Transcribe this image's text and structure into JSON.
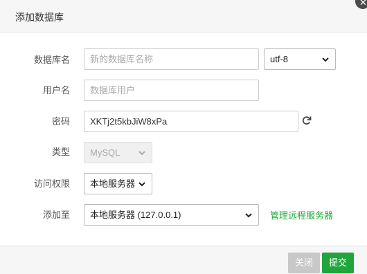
{
  "dialog": {
    "title": "添加数据库",
    "close_icon": "close-icon"
  },
  "form": {
    "db_name": {
      "label": "数据库名",
      "value": "",
      "placeholder": "新的数据库名称"
    },
    "charset": {
      "selected": "utf-8"
    },
    "username": {
      "label": "用户名",
      "value": "",
      "placeholder": "数据库用户"
    },
    "password": {
      "label": "密码",
      "value": "XKTj2t5kbJiW8xPa",
      "refresh_icon": "refresh-icon"
    },
    "type": {
      "label": "类型",
      "selected": "MySQL"
    },
    "access": {
      "label": "访问权限",
      "selected": "本地服务器"
    },
    "add_to": {
      "label": "添加至",
      "selected": "本地服务器 (127.0.0.1)"
    },
    "manage_link": "管理远程服务器"
  },
  "footer": {
    "close_label": "关闭",
    "submit_label": "提交"
  },
  "colors": {
    "accent": "#20a53a",
    "disabled_button": "#c8c8c8",
    "title_bar": "#f6f6f6"
  }
}
